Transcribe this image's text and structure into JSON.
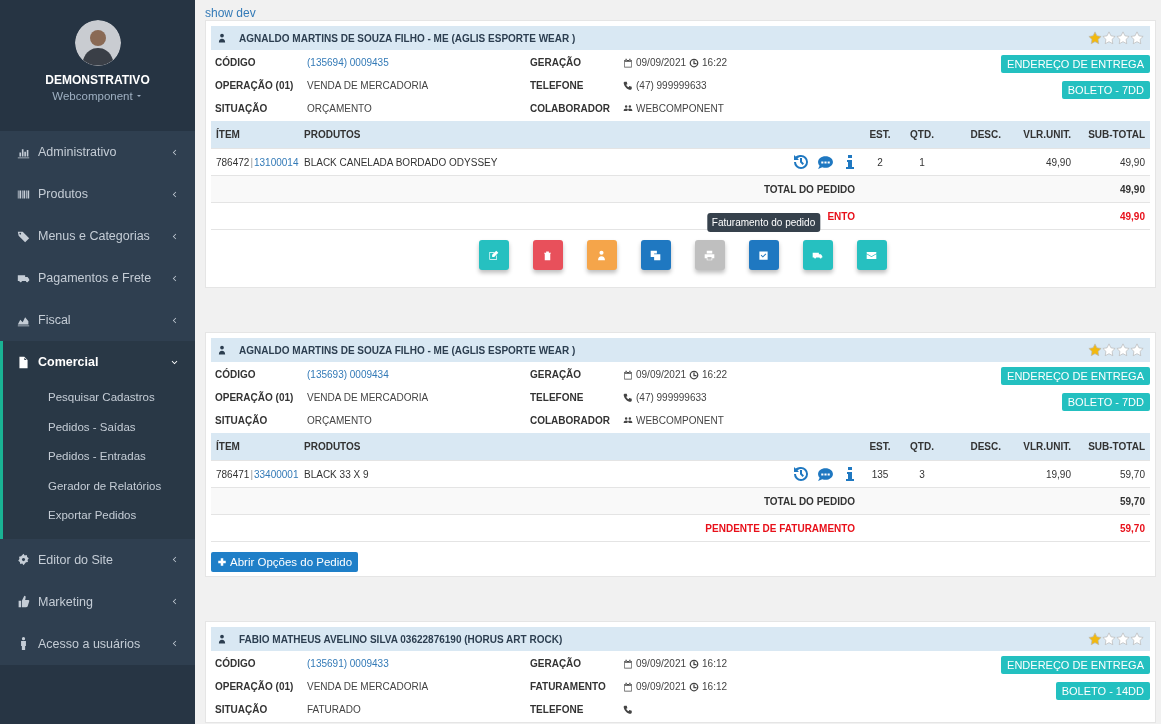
{
  "sidebar": {
    "user": {
      "name": "DEMONSTRATIVO",
      "role": "Webcomponent"
    },
    "menu": [
      {
        "label": "Administrativo",
        "selected": false,
        "expanded": false
      },
      {
        "label": "Produtos",
        "selected": false,
        "expanded": false
      },
      {
        "label": "Menus e Categorias",
        "selected": false,
        "expanded": false
      },
      {
        "label": "Pagamentos e Frete",
        "selected": false,
        "expanded": false
      },
      {
        "label": "Fiscal",
        "selected": false,
        "expanded": false
      },
      {
        "label": "Comercial",
        "selected": true,
        "expanded": true,
        "children": [
          "Pesquisar Cadastros",
          "Pedidos - Saídas",
          "Pedidos - Entradas",
          "Gerador de Relatórios",
          "Exportar Pedidos"
        ]
      },
      {
        "label": "Editor do Site",
        "selected": false,
        "expanded": false
      },
      {
        "label": "Marketing",
        "selected": false,
        "expanded": false
      },
      {
        "label": "Acesso a usuários",
        "selected": false,
        "expanded": false
      }
    ]
  },
  "dev_link": "show dev",
  "orders": [
    {
      "customer": "AGNALDO MARTINS DE SOUZA FILHO - ME (AGLIS ESPORTE WEAR )",
      "stars": 1,
      "left": [
        {
          "label": "CÓDIGO",
          "value": "(135694) 0009435",
          "kind": "link"
        },
        {
          "label": "OPERAÇÃO (01)",
          "value": "VENDA DE MERCADORIA",
          "kind": "text"
        },
        {
          "label": "SITUAÇÃO",
          "value": "ORÇAMENTO",
          "kind": "text"
        }
      ],
      "right": [
        {
          "label": "GERAÇÃO",
          "value": "09/09/2021",
          "time": "16:22",
          "kind": "date"
        },
        {
          "label": "TELEFONE",
          "value": "(47) 999999633",
          "kind": "phone"
        },
        {
          "label": "COLABORADOR",
          "value": "WEBCOMPONENT",
          "kind": "team"
        }
      ],
      "badges": [
        "ENDEREÇO DE ENTREGA",
        "BOLETO - 7DD"
      ],
      "columns": [
        "ÍTEM",
        "PRODUTOS",
        "EST.",
        "QTD.",
        "DESC.",
        "VLR.UNIT.",
        "SUB-TOTAL"
      ],
      "items": [
        {
          "item": "786472",
          "sep": "|",
          "code": "13100014",
          "product": "BLACK CANELADA BORDADO ODYSSEY",
          "est": "2",
          "qtd": "1",
          "unit": "49,90",
          "subtotal": "49,90"
        }
      ],
      "total_label": "TOTAL DO PEDIDO",
      "total": "49,90",
      "pending_label": "ENTO",
      "pending_total": "49,90",
      "actions": [
        {
          "color": "#26c0c0"
        },
        {
          "color": "#e8505b"
        },
        {
          "color": "#f5a54a"
        },
        {
          "color": "#1f78c1"
        },
        {
          "color": "#bfbfbf"
        },
        {
          "color": "#1f78c1",
          "tooltip": "Faturamento do pedido"
        },
        {
          "color": "#26c0c0"
        },
        {
          "color": "#26c0c0"
        }
      ]
    },
    {
      "customer": "AGNALDO MARTINS DE SOUZA FILHO - ME (AGLIS ESPORTE WEAR )",
      "stars": 1,
      "left": [
        {
          "label": "CÓDIGO",
          "value": "(135693) 0009434",
          "kind": "link"
        },
        {
          "label": "OPERAÇÃO (01)",
          "value": "VENDA DE MERCADORIA",
          "kind": "text"
        },
        {
          "label": "SITUAÇÃO",
          "value": "ORÇAMENTO",
          "kind": "text"
        }
      ],
      "right": [
        {
          "label": "GERAÇÃO",
          "value": "09/09/2021",
          "time": "16:22",
          "kind": "date"
        },
        {
          "label": "TELEFONE",
          "value": "(47) 999999633",
          "kind": "phone"
        },
        {
          "label": "COLABORADOR",
          "value": "WEBCOMPONENT",
          "kind": "team"
        }
      ],
      "badges": [
        "ENDEREÇO DE ENTREGA",
        "BOLETO - 7DD"
      ],
      "columns": [
        "ÍTEM",
        "PRODUTOS",
        "EST.",
        "QTD.",
        "DESC.",
        "VLR.UNIT.",
        "SUB-TOTAL"
      ],
      "items": [
        {
          "item": "786471",
          "sep": "|",
          "code": "33400001",
          "product": "BLACK 33 X 9",
          "est": "135",
          "qtd": "3",
          "unit": "19,90",
          "subtotal": "59,70"
        }
      ],
      "total_label": "TOTAL DO PEDIDO",
      "total": "59,70",
      "pending_label": "PENDENTE DE FATURAMENTO",
      "pending_total": "59,70",
      "options_button": "Abrir Opções do Pedido"
    },
    {
      "customer": "FABIO MATHEUS AVELINO SILVA 03622876190 (HORUS ART ROCK)",
      "stars": 1,
      "left": [
        {
          "label": "CÓDIGO",
          "value": "(135691) 0009433",
          "kind": "link"
        },
        {
          "label": "OPERAÇÃO (01)",
          "value": "VENDA DE MERCADORIA",
          "kind": "text"
        },
        {
          "label": "SITUAÇÃO",
          "value": "FATURADO",
          "kind": "text"
        }
      ],
      "right": [
        {
          "label": "GERAÇÃO",
          "value": "09/09/2021",
          "time": "16:12",
          "kind": "date"
        },
        {
          "label": "FATURAMENTO",
          "value": "09/09/2021",
          "time": "16:12",
          "kind": "date"
        },
        {
          "label": "TELEFONE",
          "kind": "phone"
        }
      ],
      "badges": [
        "ENDEREÇO DE ENTREGA",
        "BOLETO - 14DD"
      ]
    }
  ]
}
